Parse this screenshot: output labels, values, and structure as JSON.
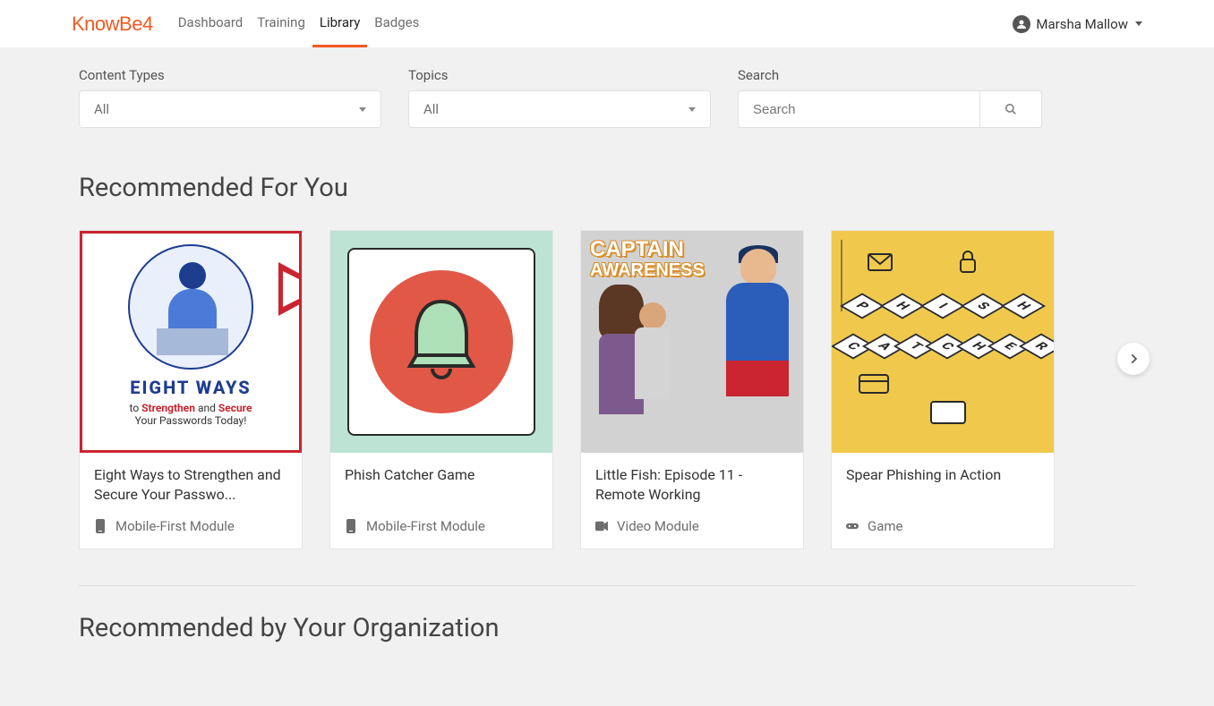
{
  "brand": "KnowBe4",
  "nav": {
    "items": [
      {
        "label": "Dashboard",
        "active": false
      },
      {
        "label": "Training",
        "active": false
      },
      {
        "label": "Library",
        "active": true
      },
      {
        "label": "Badges",
        "active": false
      }
    ]
  },
  "user": {
    "name": "Marsha Mallow"
  },
  "filters": {
    "content_types": {
      "label": "Content Types",
      "value": "All"
    },
    "topics": {
      "label": "Topics",
      "value": "All"
    },
    "search": {
      "label": "Search",
      "placeholder": "Search"
    }
  },
  "sections": {
    "recommended": {
      "title": "Recommended For You",
      "cards": [
        {
          "title": "Eight Ways to Strengthen and Secure Your Passwo...",
          "type_label": "Mobile-First Module",
          "type_icon": "mobile",
          "thumb": {
            "eight": "EIGHT WAYS",
            "sub1_prefix": "to ",
            "sub1_strong1": "Strengthen",
            "sub1_mid": " and ",
            "sub1_strong2": "Secure",
            "sub2": "Your Passwords Today!"
          }
        },
        {
          "title": "Phish Catcher Game",
          "type_label": "Mobile-First Module",
          "type_icon": "mobile"
        },
        {
          "title": "Little Fish: Episode 11 - Remote Working",
          "type_label": "Video Module",
          "type_icon": "video",
          "thumb": {
            "caption1": "CAPTAIN",
            "caption2": "AWARENESS"
          }
        },
        {
          "title": "Spear Phishing in Action",
          "type_label": "Game",
          "type_icon": "game"
        }
      ]
    },
    "org_recommended": {
      "title": "Recommended by Your Organization"
    }
  }
}
